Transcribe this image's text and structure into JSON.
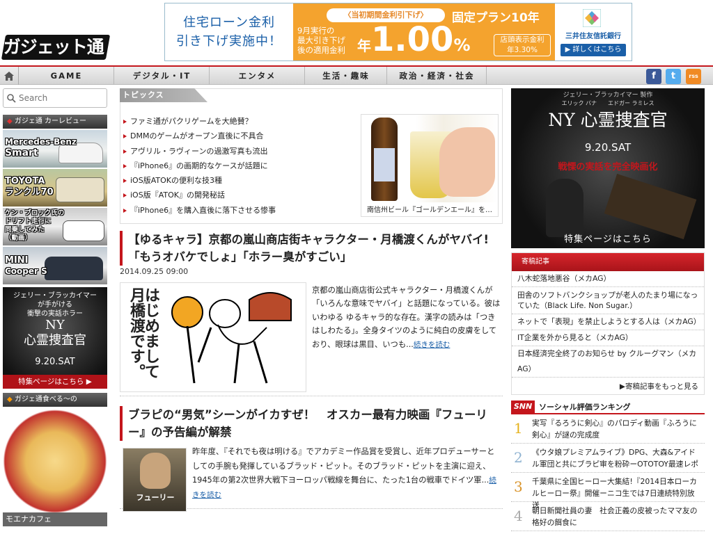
{
  "header": {
    "logo_text": "ガジェット通信",
    "banner": {
      "left_line1": "住宅ローン金利",
      "left_line2": "引き下げ実施中！",
      "pill": "〈当初期間金利引下げ〉",
      "plan": "固定プラン10年",
      "small_line1": "9月実行の",
      "small_line2": "最大引き下げ",
      "small_line3": "後の適用金利",
      "rate_prefix": "年",
      "rate": "1.00",
      "rate_unit": "%",
      "note_line1": "店頭表示金利",
      "note_line2": "年3.30%",
      "bank": "三井住友信託銀行",
      "button": "▶ 詳しくはこちら"
    }
  },
  "nav": {
    "items": [
      "GAME",
      "デジタル・IT",
      "エンタメ",
      "生活・趣味",
      "政治・経済・社会"
    ],
    "social": [
      "f",
      "t",
      "rss"
    ]
  },
  "left": {
    "search_placeholder": "Search",
    "car_header": "ガジェ通 カーレビュー",
    "cars": [
      {
        "label": "Mercedes-Benz",
        "label2": "Smart"
      },
      {
        "label": "TOYOTA",
        "label2": "ランクル70"
      },
      {
        "label": "ケン・ブロック氏の",
        "label2": "ドリフト走行に",
        "label3": "同乗してみた",
        "label4": "（動画）"
      },
      {
        "label": "MINI",
        "label2": "Cooper S"
      }
    ],
    "ad": {
      "line1": "ジェリー・ブラッカイマー",
      "line2": "が手がける",
      "line3": "衝撃の実話ホラー",
      "title1": "NY",
      "title2": "心霊捜査官",
      "date": "9.20.SAT",
      "cta": "特集ページはこちら ▶"
    },
    "food_header": "ガジェ通食べる〜の",
    "food_caption": "モエナカフェ"
  },
  "topics": {
    "tab": "トピックス",
    "items": [
      "ファミ通がパクリゲームを大絶賛？",
      "DMMのゲームがオープン直後に不具合",
      "アヴリル・ラヴィーンの過激写真も流出",
      "『iPhone6』の画期的なケースが話題に",
      "iOS版ATOKの便利な技3種",
      "iOS版『ATOK』の開発秘話",
      "『iPhone6』を購入直後に落下させる惨事"
    ],
    "image_caption": "南信州ビール『ゴールデンエール』を…"
  },
  "articles": [
    {
      "title": "【ゆるキャラ】京都の嵐山商店街キャラクター・月橋渡くんがヤバイ!「もうオバケでしょ」「ホラー臭がすごい」",
      "date": "2014.09.25 09:00",
      "thumb_text": "はじめまして 月橋渡です。",
      "body": "京都の嵐山商店街公式キャラクター・月橋渡くんが「いろんな意味でヤバイ」と話題になっている。彼はいわゆる ゆるキャラ的な存在。漢字の読みは「つきはしわたる」。全身タイツのように純白の皮膚をしており、眼球は黒目、いつも...",
      "more": "続きを読む"
    },
    {
      "title": "ブラピの“男気”シーンがイカすぜ！　オスカー最有力映画『フューリー』の予告編が解禁",
      "thumb_text": "フューリー",
      "body": "昨年度、『それでも夜は明ける』でアカデミー作品賞を受賞し、近年プロデューサーとしての手腕も発揮しているブラッド・ピット。そのブラッド・ピットを主演に迎え、1945年の第2次世界大戦下ヨーロッパ戦線を舞台に、たった1台の戦車でドイツ軍...",
      "more": "続きを読む"
    }
  ],
  "right": {
    "ad": {
      "line1": "ジェリー・ブラッカイマー 製作",
      "line2": "エリック バナ　　エドガー ラミレス",
      "title": "NY 心霊捜査官",
      "date": "9.20.SAT",
      "tagline": "戦慄の実話を完全映画化",
      "cta": "特集ページはこちら"
    },
    "contrib_header": "寄稿記事",
    "contrib_items": [
      "八木蛇落地悪谷（メカAG）",
      "田舎のソフトバンクショップが老人のたまり場になっていた（Black Life. Non Sugar.）",
      "ネットで「表現」を禁止しようとする人は（メカAG）",
      "IT企業を外から見ると（メカAG）",
      "日本経済完全終了のお知らせ by クルーグマン（メカAG）"
    ],
    "contrib_more": "▶寄稿記事をもっと見る",
    "snn_logo": "SNN",
    "snn_title": "ソーシャル評価ランキング",
    "ranking": [
      {
        "num": "1",
        "text": "実写『るろうに剣心』のパロディ動画『ふろうに剣心』が謎の完成度"
      },
      {
        "num": "2",
        "text": "《ウタ娘プレミアムライブ》DPG、大森&アイドル軍団と共にブラピ审を粉砕ーOTOTOY最速レポ"
      },
      {
        "num": "3",
        "text": "千葉県に全国ヒーロー大集結!『2014日本ローカルヒーロー祭』開催ーニコ生では7日連続特別放送"
      },
      {
        "num": "4",
        "text": "朝日新聞社員の妻　社会正義の皮被ったママ友の格好の餌食に"
      }
    ]
  }
}
